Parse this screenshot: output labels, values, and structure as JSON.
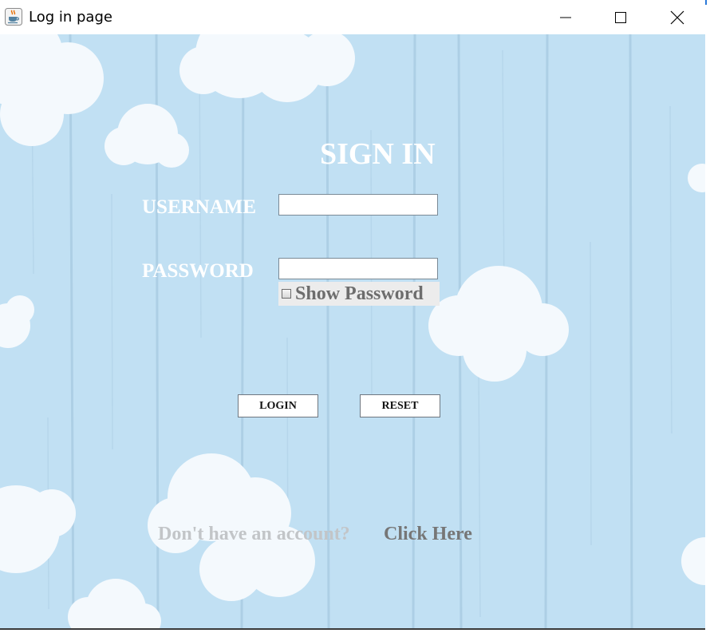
{
  "window": {
    "title": "Log in page",
    "app_icon": "java-cup-icon",
    "controls": [
      "minimize-icon",
      "maximize-icon",
      "close-icon"
    ]
  },
  "form": {
    "heading": "SIGN IN",
    "username_label": "USERNAME",
    "username_value": "",
    "password_label": "PASSWORD",
    "password_value": "",
    "show_password_label": "Show Password",
    "show_password_checked": false,
    "login_button": "LOGIN",
    "reset_button": "RESET"
  },
  "footer": {
    "prompt": "Don't have an account?",
    "link": "Click Here"
  },
  "colors": {
    "background": "#c1e0f3",
    "cloud": "#f4f9fd",
    "heading_text": "#ffffff",
    "prompt_text": "#c2c5c8",
    "link_text": "#767676"
  }
}
